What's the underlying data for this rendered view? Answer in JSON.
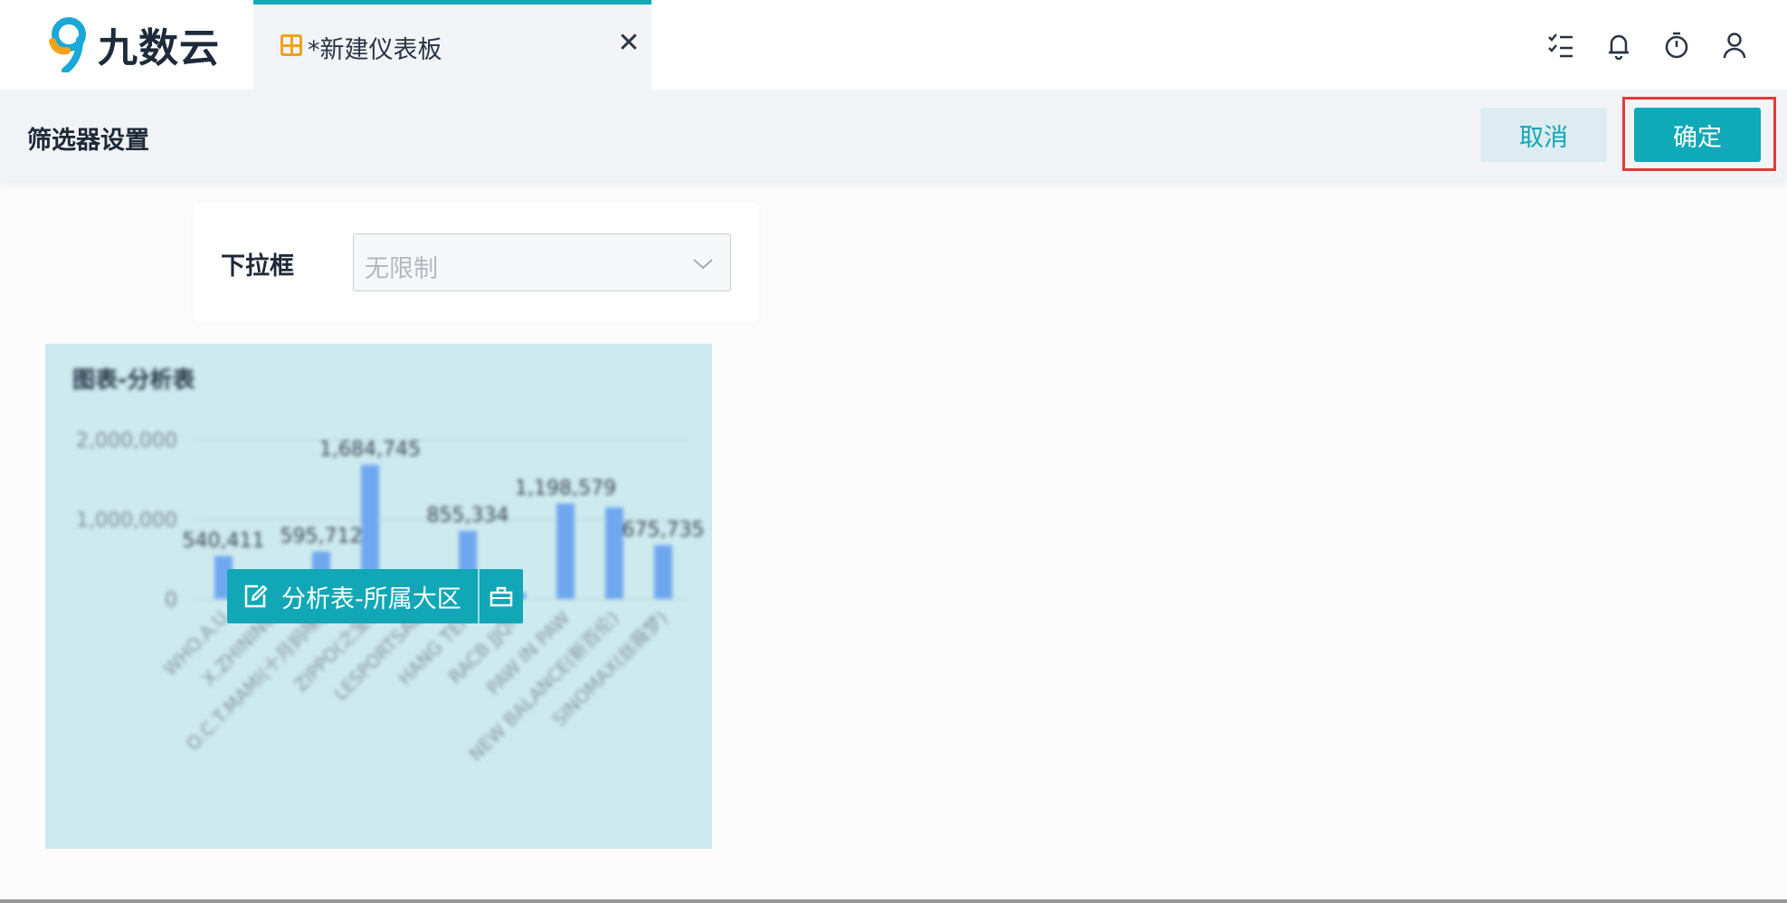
{
  "app": {
    "logo_text": "九数云"
  },
  "tab": {
    "title": "*新建仪表板",
    "close_label": "✕"
  },
  "header_icons": [
    "checklist-icon",
    "bell-icon",
    "timer-icon",
    "user-icon"
  ],
  "settings": {
    "title": "筛选器设置",
    "cancel_label": "取消",
    "confirm_label": "确定"
  },
  "filter": {
    "label": "下拉框",
    "value": "无限制"
  },
  "chart": {
    "title": "图表-分析表",
    "widget_label": "分析表-所属大区"
  },
  "chart_data": {
    "type": "bar",
    "title": "图表-分析表",
    "categories": [
      "WHO.A.U",
      "X.ZHINING",
      "O.C.T.MAMI(十月妈咪)",
      "ZIPPO(之宝)",
      "LESPORTSAC",
      "HANG TEN",
      "RACB JJQN",
      "PAW IN PAW",
      "NEW BALANCE(新百伦)",
      "SINOMAX(丝薇梦)"
    ],
    "values": [
      540411,
      120000,
      595712,
      1684745,
      130000,
      855334,
      82000,
      1198579,
      1150000,
      675735
    ],
    "value_labels": [
      "540,411",
      "",
      "595,712",
      "1,684,745",
      "",
      "855,334",
      "",
      "1,198,579",
      "",
      "675,735"
    ],
    "yticks": [
      "0",
      "1,000,000",
      "2,000,000"
    ],
    "ylim": [
      0,
      2000000
    ],
    "color": "#6fa7ef"
  },
  "colors": {
    "accent": "#10a9b8",
    "highlight_frame": "#e23b3b",
    "tab_icon": "#f0a21a"
  }
}
